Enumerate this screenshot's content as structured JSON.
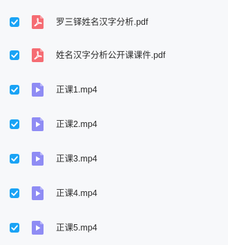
{
  "colors": {
    "checkbox": "#1aa3f5",
    "pdf_icon": "#f56c73",
    "video_icon": "#8f8cf4",
    "text": "#2b2b2b",
    "background": "#f7f8fa"
  },
  "files": [
    {
      "name": "罗三铎姓名汉字分析.pdf",
      "type": "pdf",
      "icon": "pdf-file-icon",
      "checked": true
    },
    {
      "name": "姓名汉字分析公开课课件.pdf",
      "type": "pdf",
      "icon": "pdf-file-icon",
      "checked": true
    },
    {
      "name": "正课1.mp4",
      "type": "video",
      "icon": "video-file-icon",
      "checked": true
    },
    {
      "name": "正课2.mp4",
      "type": "video",
      "icon": "video-file-icon",
      "checked": true
    },
    {
      "name": "正课3.mp4",
      "type": "video",
      "icon": "video-file-icon",
      "checked": true
    },
    {
      "name": "正课4.mp4",
      "type": "video",
      "icon": "video-file-icon",
      "checked": true
    },
    {
      "name": "正课5.mp4",
      "type": "video",
      "icon": "video-file-icon",
      "checked": true
    }
  ]
}
